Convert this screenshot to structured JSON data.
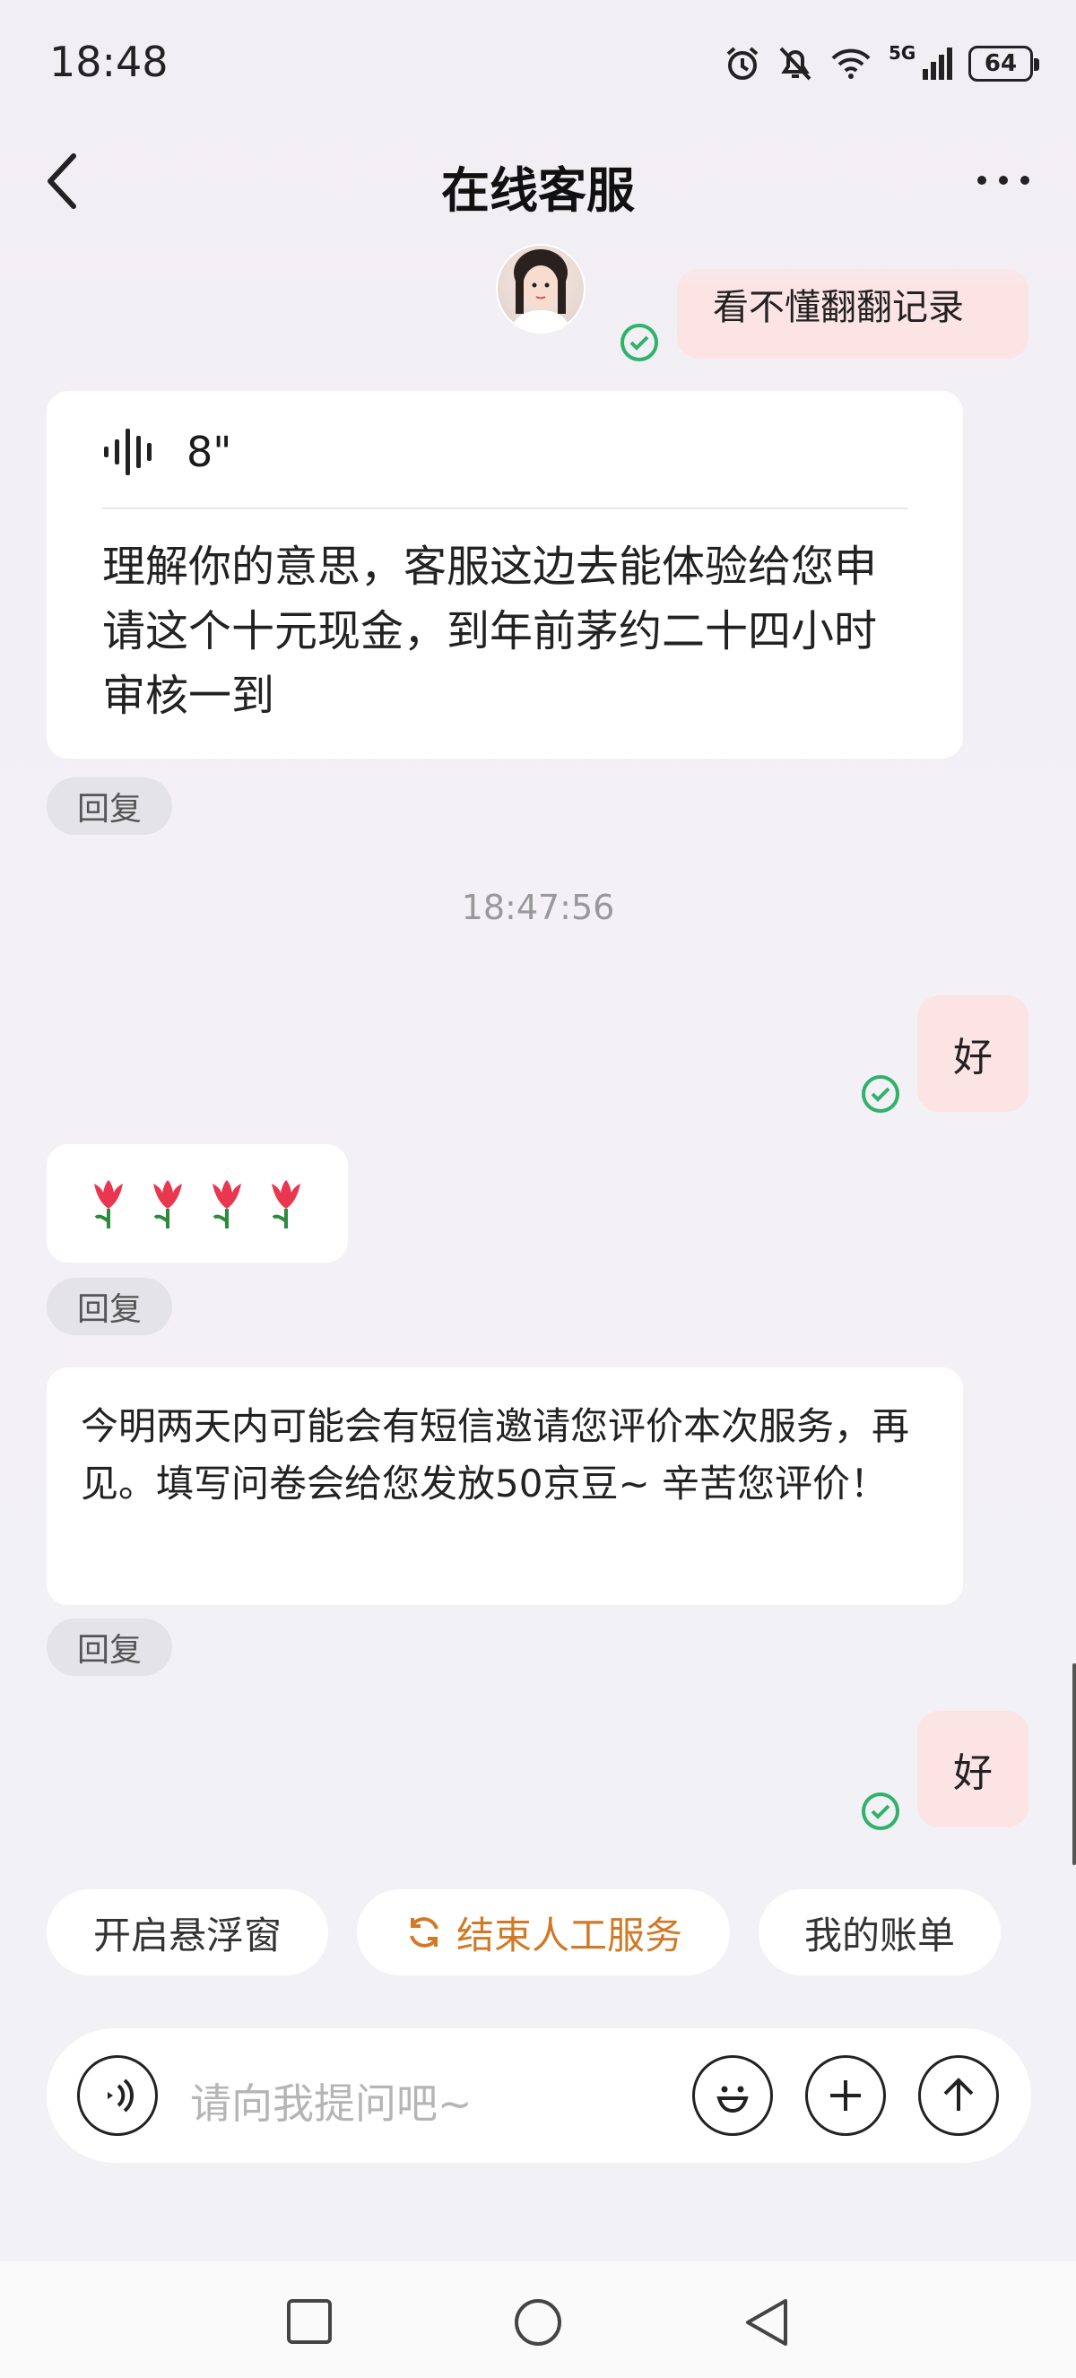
{
  "status_bar": {
    "time": "18:48",
    "network": "5G",
    "battery": "64"
  },
  "header": {
    "title": "在线客服"
  },
  "messages": {
    "partial_user_text": "看不懂翻翻记录",
    "voice_duration": "8\"",
    "voice_transcript": "理解你的意思，客服这边去能体验给您申请这个十元现金，到年前茅约二十四小时审核一到",
    "reply_label": "回复",
    "timestamp": "18:47:56",
    "user_reply_1": "好",
    "flowers": "🌷🌷🌷🌷",
    "info_text": "今明两天内可能会有短信邀请您评价本次服务，再见。填写问卷会给您发放50京豆~ 辛苦您评价！",
    "user_reply_2": "好"
  },
  "quick_actions": {
    "float_window": "开启悬浮窗",
    "end_service": "结束人工服务",
    "my_bill": "我的账单"
  },
  "input": {
    "placeholder": "请向我提问吧~"
  },
  "colors": {
    "user_bubble": "#fde4e4",
    "check_green": "#2fb26a",
    "accent_orange": "#d07a28"
  }
}
